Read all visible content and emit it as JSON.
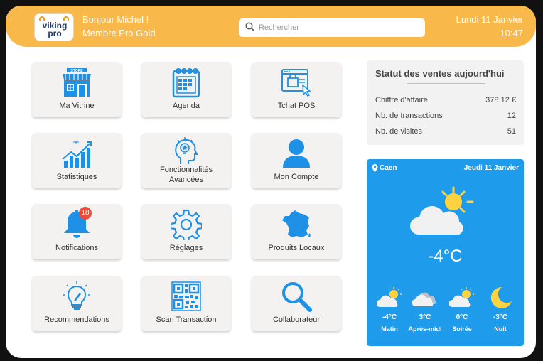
{
  "header": {
    "logo_line1": "viking",
    "logo_line2": "pro",
    "greeting": "Bonjour Michel !",
    "membership": "Membre Pro Gold",
    "search_placeholder": "Rechercher",
    "date": "Lundi 11 Janvier",
    "time": "10:47"
  },
  "tiles": [
    {
      "label": "Ma Vitrine",
      "icon": "store-icon"
    },
    {
      "label": "Agenda",
      "icon": "calendar-icon"
    },
    {
      "label": "Tchat POS",
      "icon": "chat-window-icon"
    },
    {
      "label": "Statistiques",
      "icon": "bar-chart-icon"
    },
    {
      "label": "Fonctionnalités Avancées",
      "icon": "lightbulb-head-icon"
    },
    {
      "label": "Mon Compte",
      "icon": "user-icon"
    },
    {
      "label": "Notifications",
      "icon": "bell-icon",
      "badge": "18"
    },
    {
      "label": "Réglages",
      "icon": "gear-icon"
    },
    {
      "label": "Produits Locaux",
      "icon": "france-map-icon"
    },
    {
      "label": "Recommendations",
      "icon": "lightbulb-pencil-icon"
    },
    {
      "label": "Scan Transaction",
      "icon": "qr-code-icon"
    },
    {
      "label": "Collaborateur",
      "icon": "magnifier-icon"
    }
  ],
  "stats": {
    "title": "Statut des ventes aujourd'hui",
    "rows": [
      {
        "label": "Chiffre d'affaire",
        "value": "378.12 €"
      },
      {
        "label": "Nb. de transactions",
        "value": "12"
      },
      {
        "label": "Nb. de visites",
        "value": "51"
      }
    ]
  },
  "weather": {
    "city": "Caen",
    "date": "Jeudi 11 Janvier",
    "current_temp": "-4°C",
    "forecast": [
      {
        "temp": "-4°C",
        "label": "Matin",
        "icon": "sun-cloud-icon"
      },
      {
        "temp": "3°C",
        "label": "Après-midi",
        "icon": "cloud-icon"
      },
      {
        "temp": "0°C",
        "label": "Soirée",
        "icon": "sun-cloud-icon"
      },
      {
        "temp": "-3°C",
        "label": "Nuit",
        "icon": "moon-icon"
      }
    ]
  },
  "colors": {
    "header": "#f9b84a",
    "icon_blue": "#1e90e6",
    "weather_bg": "#1e9bea",
    "badge": "#e74c3c",
    "sun": "#ffd23f"
  }
}
